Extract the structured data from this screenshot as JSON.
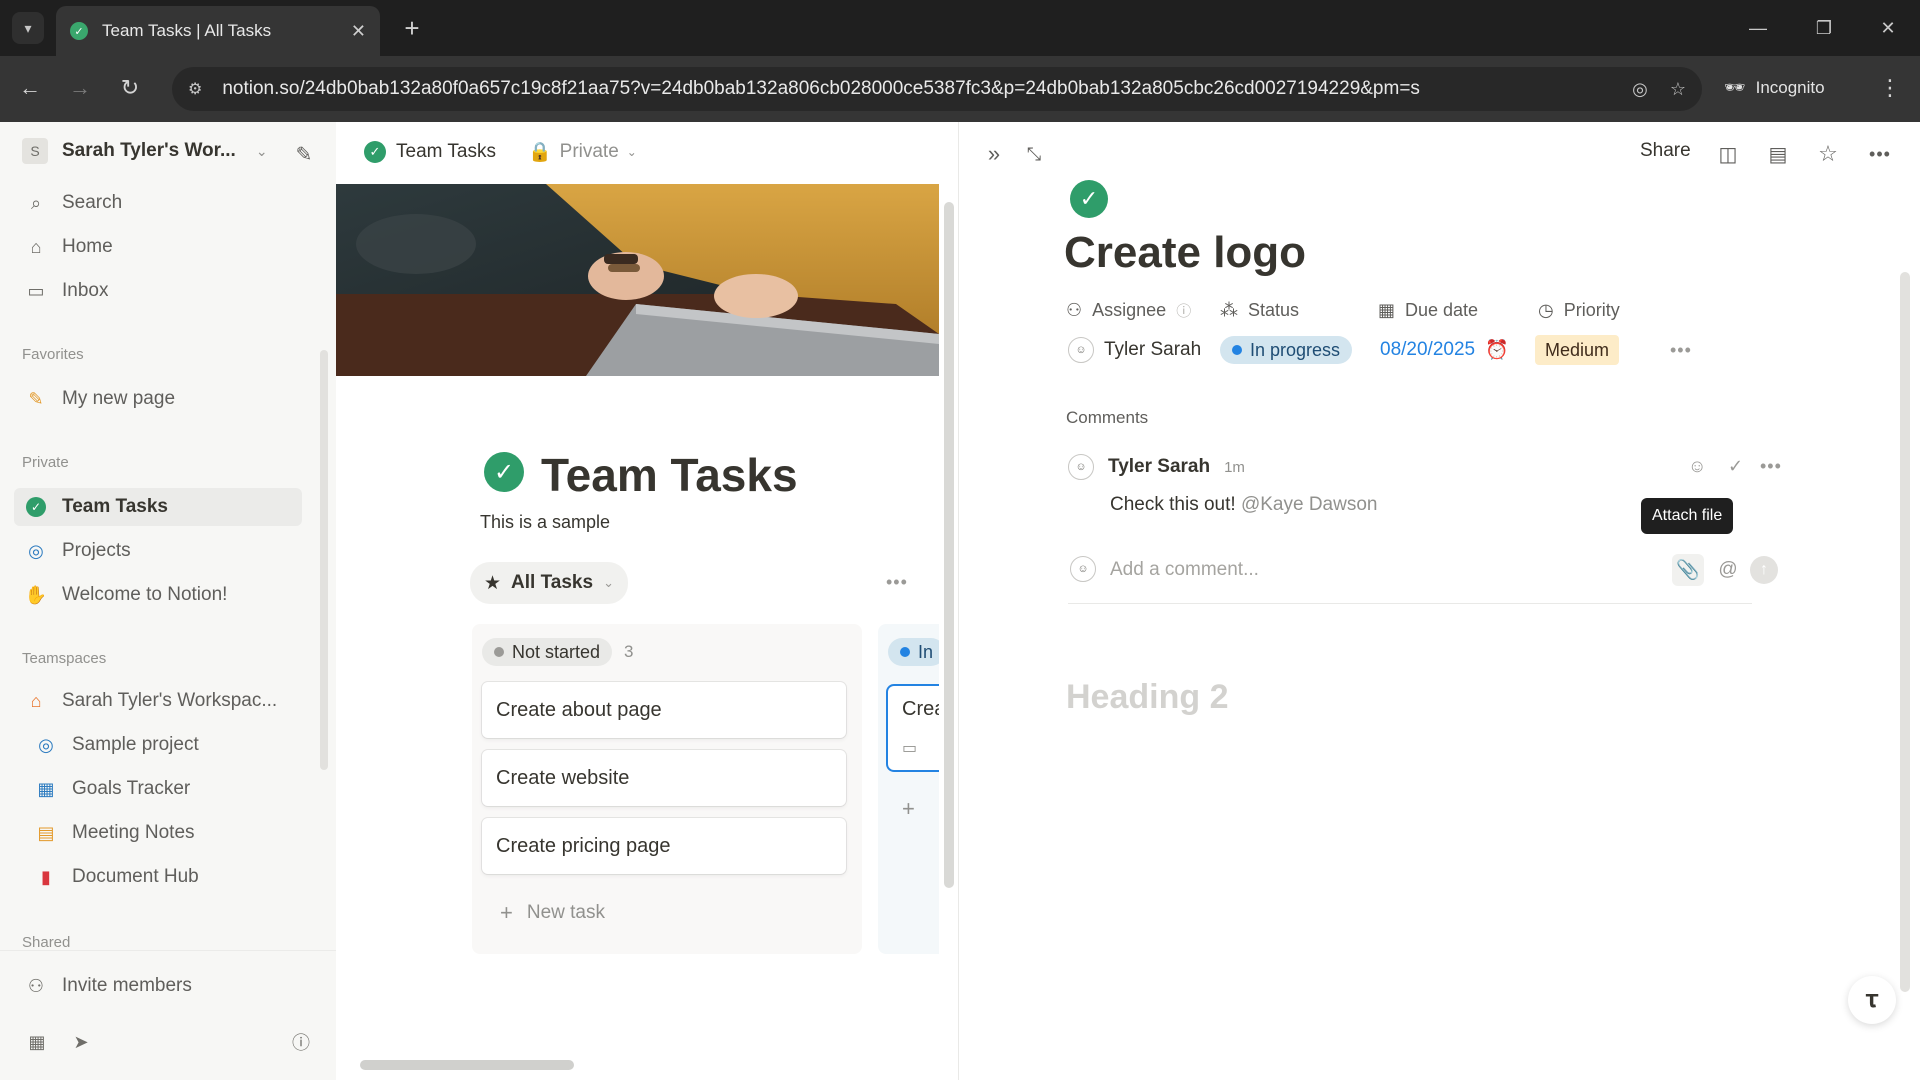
{
  "browser": {
    "tab_title": "Team Tasks | All Tasks",
    "url": "notion.so/24db0bab132a80f0a657c19c8f21aa75?v=24db0bab132a806cb028000ce5387fc3&p=24db0bab132a805cbc26cd0027194229&pm=s",
    "incognito_label": "Incognito"
  },
  "sidebar": {
    "workspace_name": "Sarah Tyler's Wor...",
    "workspace_initial": "S",
    "top_items": [
      {
        "label": "Search",
        "icon": "search-icon"
      },
      {
        "label": "Home",
        "icon": "home-icon"
      },
      {
        "label": "Inbox",
        "icon": "inbox-icon"
      }
    ],
    "favorites_heading": "Favorites",
    "favorites": [
      {
        "label": "My new page",
        "icon": "pencil-icon"
      }
    ],
    "private_heading": "Private",
    "private": [
      {
        "label": "Team Tasks",
        "icon": "check-circle-icon"
      },
      {
        "label": "Projects",
        "icon": "target-icon"
      },
      {
        "label": "Welcome to Notion!",
        "icon": "wave-icon"
      }
    ],
    "teamspaces_heading": "Teamspaces",
    "teamspace_name": "Sarah Tyler's Workspac...",
    "teamspace_items": [
      {
        "label": "Sample project",
        "icon": "target-icon"
      },
      {
        "label": "Goals Tracker",
        "icon": "chart-icon"
      },
      {
        "label": "Meeting Notes",
        "icon": "calendar-icon"
      },
      {
        "label": "Document Hub",
        "icon": "document-icon"
      }
    ],
    "shared_heading": "Shared",
    "invite_label": "Invite members"
  },
  "main": {
    "breadcrumb": "Team Tasks",
    "privacy": "Private",
    "title": "Team Tasks",
    "description": "This is a sample",
    "view_name": "All Tasks",
    "board": {
      "column_status": "Not started",
      "column_count": "3",
      "cards": [
        "Create about page",
        "Create website",
        "Create pricing page"
      ],
      "new_task_label": "New task",
      "column2_status": "In",
      "column2_card_text": "Crea"
    }
  },
  "peek": {
    "share_label": "Share",
    "title": "Create logo",
    "props": {
      "assignee_label": "Assignee",
      "status_label": "Status",
      "due_label": "Due date",
      "priority_label": "Priority",
      "assignee_value": "Tyler Sarah",
      "status_value": "In progress",
      "due_value": "08/20/2025",
      "priority_value": "Medium"
    },
    "comments_heading": "Comments",
    "comment": {
      "author": "Tyler Sarah",
      "time": "1m",
      "text": "Check this out!",
      "mention": "@Kaye Dawson"
    },
    "tooltip": "Attach file",
    "add_comment_placeholder": "Add a comment...",
    "heading_placeholder": "Heading 2"
  },
  "colors": {
    "green": "#2f9d6a",
    "status_blue": "#2383e2",
    "priority_yellow": "#fdecc8"
  }
}
